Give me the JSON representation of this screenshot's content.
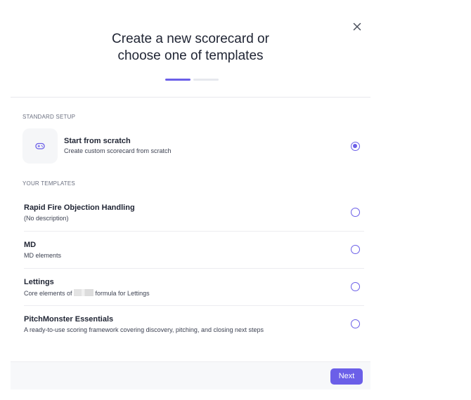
{
  "modal": {
    "title": "Create a new scorecard or\nchoose one of templates",
    "close_icon": "close-icon",
    "steps": {
      "current": 1,
      "total": 2
    }
  },
  "standard_setup": {
    "label": "STANDARD SETUP",
    "option": {
      "icon": "gamepad-icon",
      "title": "Start from scratch",
      "description": "Create custom scorecard from scratch",
      "selected": true
    }
  },
  "your_templates": {
    "label": "YOUR TEMPLATES",
    "items": [
      {
        "title": "Rapid Fire Objection Handling",
        "description": "(No description)",
        "selected": false
      },
      {
        "title": "MD",
        "description": "MD elements",
        "selected": false
      },
      {
        "title": "Lettings",
        "description_before": "Core elements of ",
        "description_after": " formula for Lettings",
        "selected": false
      },
      {
        "title": "PitchMonster Essentials",
        "description": "A ready-to-use scoring framework covering discovery, pitching, and closing next steps",
        "selected": false
      }
    ]
  },
  "footer": {
    "next_label": "Next"
  },
  "colors": {
    "accent": "#6b5fe8",
    "text": "#1f2433",
    "muted": "#6b7080"
  }
}
